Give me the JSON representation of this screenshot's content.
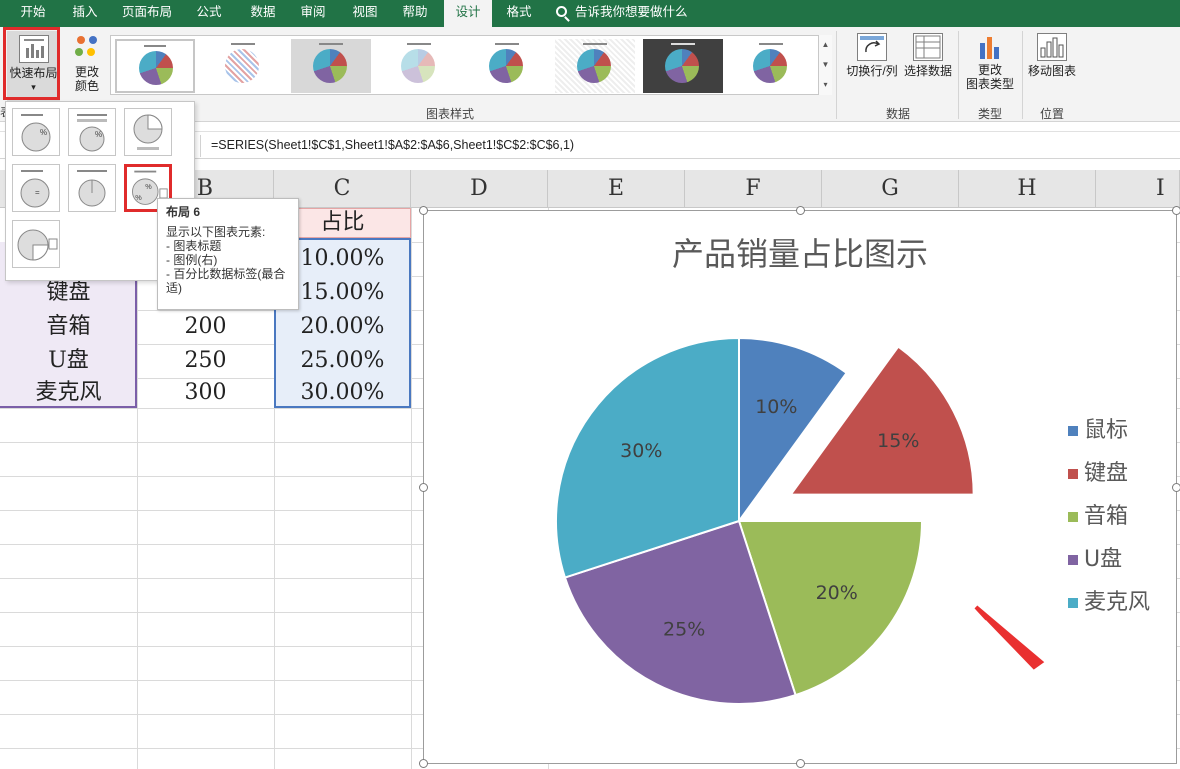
{
  "tabs": [
    "开始",
    "插入",
    "页面布局",
    "公式",
    "数据",
    "审阅",
    "视图",
    "帮助",
    "设计",
    "格式"
  ],
  "active_tab": "设计",
  "tell_me_placeholder": "告诉我你想要做什么",
  "ribbon": {
    "quick_layout": "快速布局",
    "quick_layout_arrow": "▾",
    "change_colors_line1": "更改",
    "change_colors_line2": "颜色",
    "chart_styles_group": "图表样式",
    "switch_row_col": "切换行/列",
    "select_data": "选择数据",
    "data_group": "数据",
    "change_type_line1": "更改",
    "change_type_line2": "图表类型",
    "type_group": "类型",
    "move_chart": "移动图表",
    "location_group": "位置",
    "truncated_group_char": "表"
  },
  "formula_bar": "=SERIES(Sheet1!$C$1,Sheet1!$A$2:$A$6,Sheet1!$C$2:$C$6,1)",
  "columns": [
    "B",
    "C",
    "D",
    "E",
    "F",
    "G",
    "H",
    "I"
  ],
  "table": {
    "header_c": "占比",
    "rows": [
      {
        "a": "",
        "b": "",
        "c": "10.00%"
      },
      {
        "a": "键盘",
        "b": "",
        "c": "15.00%"
      },
      {
        "a": "音箱",
        "b": "200",
        "c": "20.00%"
      },
      {
        "a": "U盘",
        "b": "250",
        "c": "25.00%"
      },
      {
        "a": "麦克风",
        "b": "300",
        "c": "30.00%"
      }
    ]
  },
  "layout_tooltip": {
    "title": "布局 6",
    "desc": "显示以下图表元素:",
    "items": [
      "- 图表标题",
      "- 图例(右)",
      "- 百分比数据标签(最合适)"
    ]
  },
  "colors": {
    "excel_green": "#217346",
    "blue": "#4f81bd",
    "red": "#c0504d",
    "green": "#9bbb59",
    "purple": "#8064a2",
    "teal": "#4bacc6",
    "highlight_red": "#e02b2b"
  },
  "chart_data": {
    "type": "pie",
    "title": "产品销量占比图示",
    "categories": [
      "鼠标",
      "键盘",
      "音箱",
      "U盘",
      "麦克风"
    ],
    "values": [
      10,
      15,
      20,
      25,
      30
    ],
    "labels": [
      "10%",
      "15%",
      "20%",
      "25%",
      "30%"
    ],
    "colors": [
      "#4f81bd",
      "#c0504d",
      "#9bbb59",
      "#8064a2",
      "#4bacc6"
    ],
    "exploded_index": 1,
    "legend": "right"
  }
}
